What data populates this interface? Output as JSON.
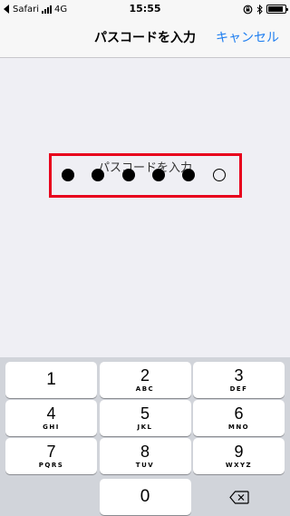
{
  "status_bar": {
    "back_app": "Safari",
    "network": "4G",
    "time": "15:55"
  },
  "nav": {
    "title": "パスコードを入力",
    "cancel_label": "キャンセル"
  },
  "passcode": {
    "prompt": "パスコードを入力",
    "total_digits": 6,
    "entered_digits": 5,
    "highlight_color": "#e8001c"
  },
  "keypad": {
    "keys": [
      {
        "number": "1",
        "letters": ""
      },
      {
        "number": "2",
        "letters": "ABC"
      },
      {
        "number": "3",
        "letters": "DEF"
      },
      {
        "number": "4",
        "letters": "GHI"
      },
      {
        "number": "5",
        "letters": "JKL"
      },
      {
        "number": "6",
        "letters": "MNO"
      },
      {
        "number": "7",
        "letters": "PQRS"
      },
      {
        "number": "8",
        "letters": "TUV"
      },
      {
        "number": "9",
        "letters": "WXYZ"
      },
      {
        "number": "0",
        "letters": ""
      }
    ],
    "delete_icon": "backspace-icon"
  },
  "colors": {
    "accent": "#1f7ef0",
    "background": "#efeff4",
    "keypad_background": "#d1d4da"
  }
}
